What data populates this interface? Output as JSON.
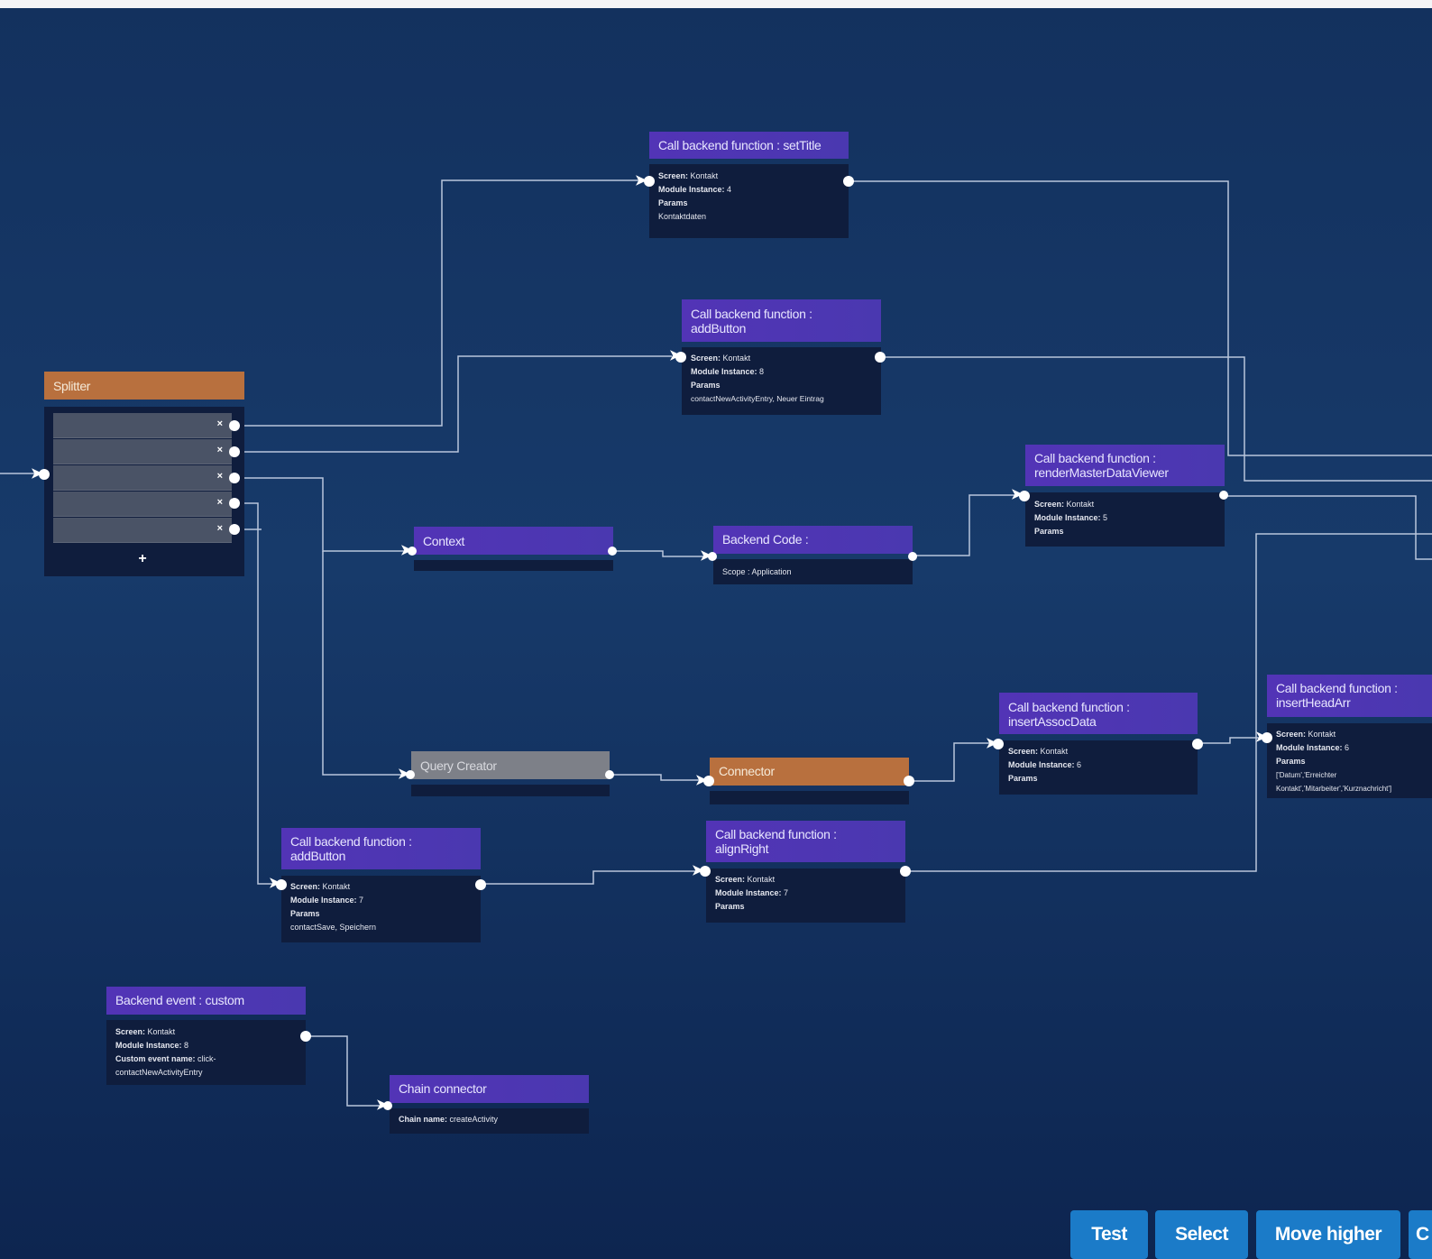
{
  "nodes": {
    "set_title": {
      "title": "Call backend function : setTitle",
      "screen_label": "Screen:",
      "screen": "Kontakt",
      "module_label": "Module Instance:",
      "module": "4",
      "params_label": "Params",
      "params": "Kontaktdaten"
    },
    "add_button_top": {
      "title_line1": "Call backend function :",
      "title_line2": "addButton",
      "screen_label": "Screen:",
      "screen": "Kontakt",
      "module_label": "Module Instance:",
      "module": "8",
      "params_label": "Params",
      "params": "contactNewActivityEntry, Neuer Eintrag"
    },
    "splitter": {
      "title": "Splitter",
      "add_symbol": "+",
      "remove_symbol": "×"
    },
    "render_master": {
      "title_line1": "Call backend function :",
      "title_line2": "renderMasterDataViewer",
      "screen_label": "Screen:",
      "screen": "Kontakt",
      "module_label": "Module Instance:",
      "module": "5",
      "params_label": "Params"
    },
    "context": {
      "title": "Context"
    },
    "backend_code": {
      "title": "Backend Code :",
      "scope": "Scope : Application"
    },
    "insert_head_arr": {
      "title_line1": "Call backend function :",
      "title_line2": "insertHeadArr",
      "screen_label": "Screen:",
      "screen": "Kontakt",
      "module_label": "Module Instance:",
      "module": "6",
      "params_label": "Params",
      "params_line1": "['Datum','Erreichter",
      "params_line2": "Kontakt','Mitarbeiter','Kurznachricht']"
    },
    "insert_assoc": {
      "title_line1": "Call backend function :",
      "title_line2": "insertAssocData",
      "screen_label": "Screen:",
      "screen": "Kontakt",
      "module_label": "Module Instance:",
      "module": "6",
      "params_label": "Params"
    },
    "query_creator": {
      "title": "Query Creator"
    },
    "connector": {
      "title": "Connector"
    },
    "add_button_bottom": {
      "title_line1": "Call backend function :",
      "title_line2": "addButton",
      "screen_label": "Screen:",
      "screen": "Kontakt",
      "module_label": "Module Instance:",
      "module": "7",
      "params_label": "Params",
      "params": "contactSave, Speichern"
    },
    "align_right": {
      "title_line1": "Call backend function :",
      "title_line2": "alignRight",
      "screen_label": "Screen:",
      "screen": "Kontakt",
      "module_label": "Module Instance:",
      "module": "7",
      "params_label": "Params"
    },
    "backend_event": {
      "title": "Backend event : custom",
      "screen_label": "Screen:",
      "screen": "Kontakt",
      "module_label": "Module Instance:",
      "module": "8",
      "event_label": "Custom event name:",
      "event_line1": "click-",
      "event_line2": "contactNewActivityEntry"
    },
    "chain_connector": {
      "title": "Chain connector",
      "chain_label": "Chain name:",
      "chain": "createActivity"
    }
  },
  "toolbar": {
    "test_label": "Test",
    "select_label": "Select",
    "move_higher_label": "Move higher",
    "partial_label": "C"
  },
  "colors": {
    "background": "#173a6a",
    "purple_header": "#5234b6",
    "orange_header": "#b8703e",
    "gray_header": "#7d8088",
    "node_body": "#0f1d3d",
    "button": "#1b7bc8"
  }
}
